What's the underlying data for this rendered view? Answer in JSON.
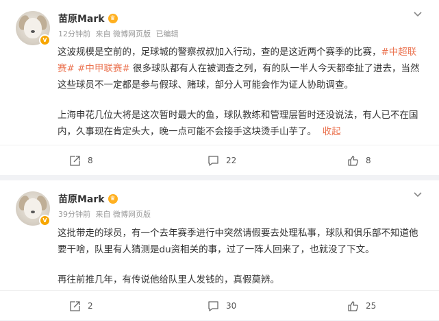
{
  "posts": [
    {
      "user": {
        "name": "苗原Mark",
        "verified_badge": "V"
      },
      "meta": {
        "time": "12分钟前",
        "source": "来自 微博网页版",
        "edited": "已编辑"
      },
      "content": {
        "p1_a": "这波规模是空前的，足球城的警察叔叔加入行动，查的是这近两个赛季的比赛，",
        "tag1": "#中超联赛#",
        "tag2": "#中甲联赛#",
        "p1_b": "很多球队都有人在被调查之列，有的队一半人今天都牵扯了进去，当然这些球员不一定都是参与假球、赌球，部分人可能会作为证人协助调查。",
        "p2": "上海申花几位大将是这次暂时最大的鱼，球队教练和管理层暂时还没说法，有人已不在国内，久事现在肯定头大，晚一点可能不会接手这块烫手山芋了。",
        "collapse": "收起"
      },
      "actions": {
        "repost": "8",
        "comment": "22",
        "like": "8"
      }
    },
    {
      "user": {
        "name": "苗原Mark",
        "verified_badge": "V"
      },
      "meta": {
        "time": "39分钟前",
        "source": "来自 微博网页版"
      },
      "content": {
        "p1": "这批带走的球员，有一个去年赛季进行中突然请假要去处理私事，球队和俱乐部不知道他要干啥，队里有人猜测是du资相关的事，过了一阵人回来了，也就没了下文。",
        "p2": "再往前推几年，有传说他给队里人发钱的，真假莫辨。"
      },
      "actions": {
        "repost": "2",
        "comment": "30",
        "like": "25"
      }
    }
  ],
  "colors": {
    "accent": "#eb7350",
    "badge": "#f7a600",
    "meta": "#999999",
    "background": "#f1f2f5"
  },
  "icons": [
    "chevron-down-icon",
    "repost-icon",
    "comment-icon",
    "like-icon",
    "crown-icon"
  ]
}
